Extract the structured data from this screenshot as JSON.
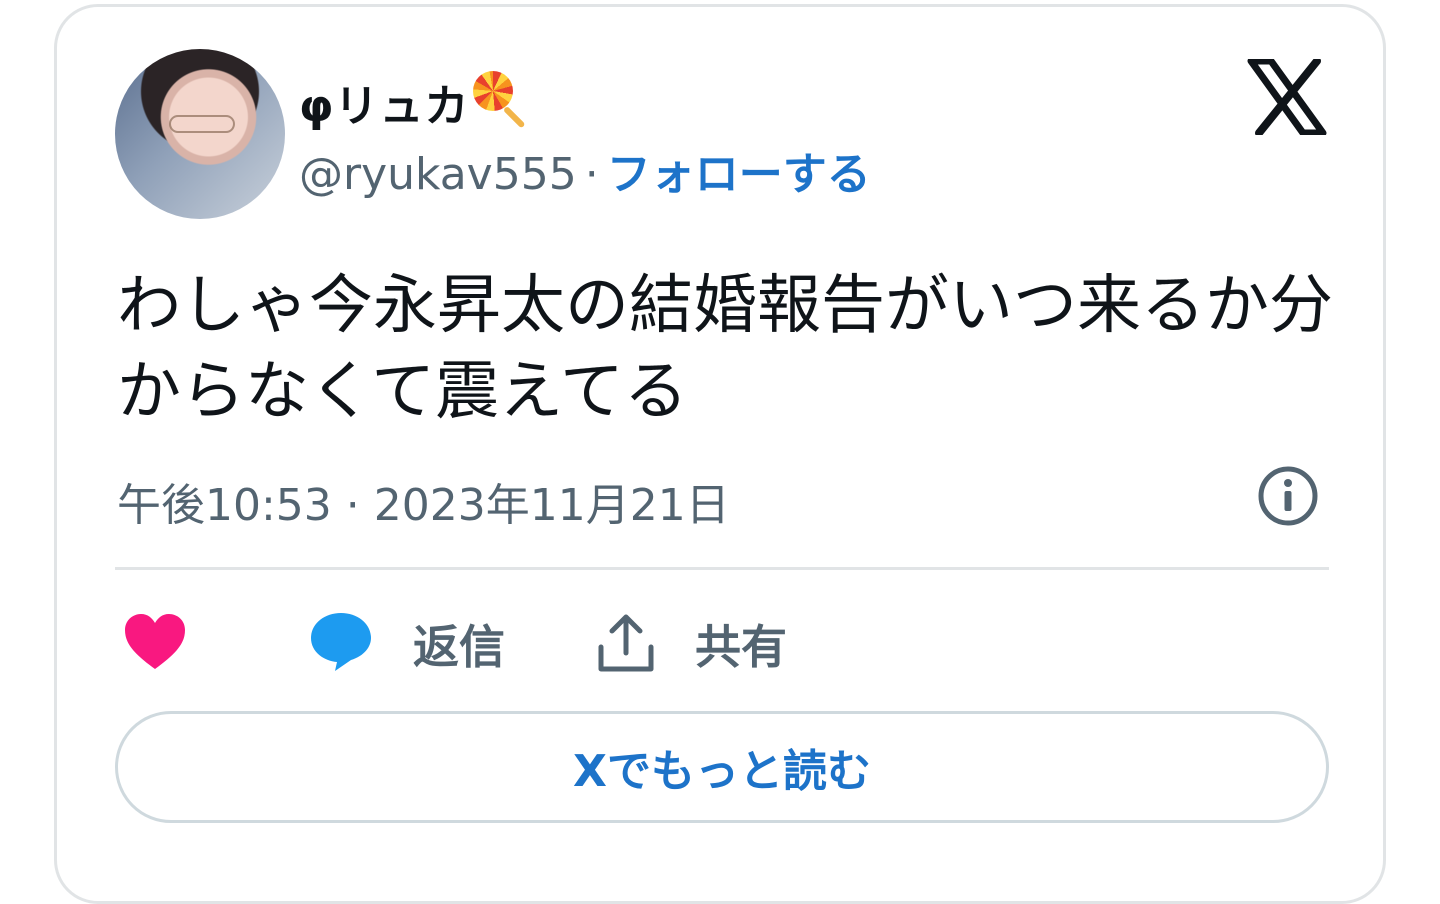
{
  "author": {
    "display_name": "φリュカ",
    "emoji_icon": "lollipop-icon",
    "handle": "@ryukav555",
    "separator": "·",
    "follow_label": "フォローする"
  },
  "tweet": {
    "text": "わしゃ今永昇太の結婚報告がいつ来るか分からなくて震えてる",
    "timestamp": "午後10:53 · 2023年11月21日"
  },
  "actions": {
    "like_icon": "heart-icon",
    "reply_label": "返信",
    "share_label": "共有"
  },
  "read_more_label": "Xでもっと読む",
  "colors": {
    "link_blue": "#1d73c9",
    "heart_pink": "#f91880",
    "reply_blue": "#1d9bf0",
    "muted_text": "#536471",
    "main_text": "#0f1419",
    "border": "#e1e4e6"
  }
}
